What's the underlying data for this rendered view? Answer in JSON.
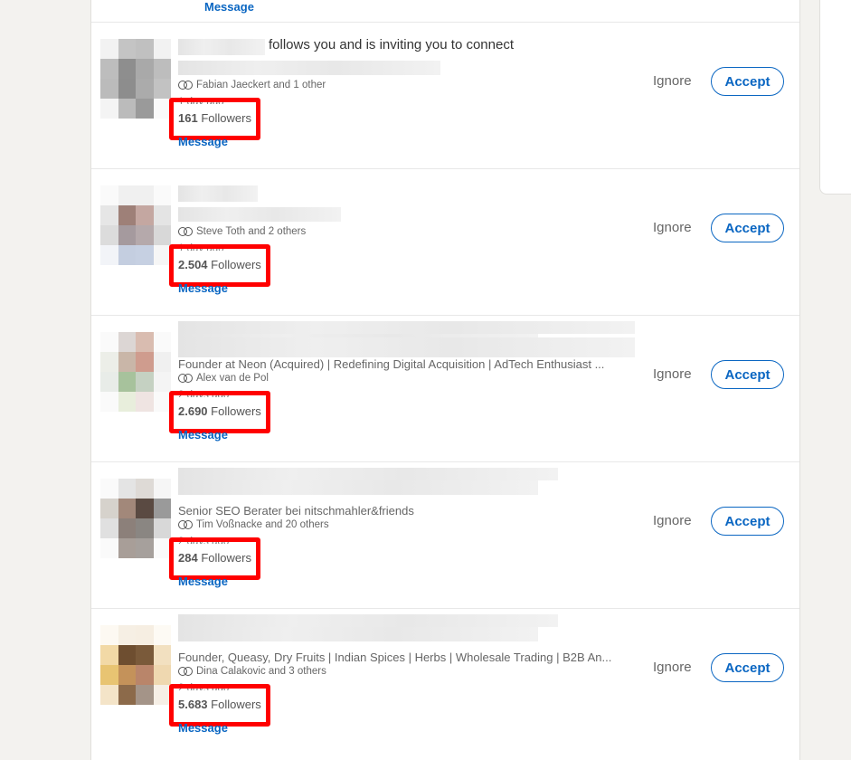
{
  "top_partial_link": "Message",
  "invitations": [
    {
      "name_suffix": "follows you and is inviting you to connect",
      "headline": "",
      "mutual": "Fabian Jaeckert and 1 other",
      "time": "1 day ago",
      "followers_count": "161",
      "followers_label": "Followers",
      "message": "Message",
      "ignore": "Ignore",
      "accept": "Accept",
      "avatar_colors": [
        "#f2f2f2",
        "#c4c4c4",
        "#c0c0c0",
        "#f2f2f2",
        "#bdbdbd",
        "#8e8e8e",
        "#a9a9a9",
        "#bdbdbd",
        "#bbbbbb",
        "#8d8d8d",
        "#ababab",
        "#c2c2c2",
        "#f4f4f4",
        "#bbbbbb",
        "#9a9a9a",
        "#fafafa"
      ]
    },
    {
      "name_suffix": "",
      "headline": "",
      "mutual": "Steve Toth and 2 others",
      "time": "1 day ago",
      "followers_count": "2.504",
      "followers_label": "Followers",
      "message": "Message",
      "ignore": "Ignore",
      "accept": "Accept",
      "avatar_colors": [
        "#fafafa",
        "#f0f0f0",
        "#f0f0f0",
        "#fafafa",
        "#e6e6e6",
        "#9e8078",
        "#c4a7a1",
        "#e4e4e4",
        "#dcdcdc",
        "#a59a9e",
        "#b5a9ab",
        "#d8d8d8",
        "#f2f4f8",
        "#c4cee0",
        "#c6d0e2",
        "#f6f6f6"
      ]
    },
    {
      "name_suffix": "",
      "headline": "Founder at Neon (Acquired) | Redefining Digital Acquisition | AdTech Enthusiast ...",
      "mutual": "Alex van de Pol",
      "time": "2 days ago",
      "followers_count": "2.690",
      "followers_label": "Followers",
      "message": "Message",
      "ignore": "Ignore",
      "accept": "Accept",
      "avatar_colors": [
        "#fafafa",
        "#dcd6d4",
        "#d9bcb0",
        "#fafafa",
        "#eceee8",
        "#c9b6a8",
        "#cf9c8e",
        "#f0f0f0",
        "#e8ece8",
        "#a7c29c",
        "#c5d1c2",
        "#f4f4f4",
        "#fafafa",
        "#e8eedc",
        "#efe4e2",
        "#fafafa"
      ]
    },
    {
      "name_suffix": "",
      "headline": "Senior SEO Berater bei nitschmahler&friends",
      "mutual": "Tim Voßnacke and 20 others",
      "time": "2 days ago",
      "followers_count": "284",
      "followers_label": "Followers",
      "message": "Message",
      "ignore": "Ignore",
      "accept": "Accept",
      "avatar_colors": [
        "#fafafa",
        "#e4e4e4",
        "#dedad6",
        "#f6f6f6",
        "#d6d2cc",
        "#a2887a",
        "#5a4a42",
        "#9a9a9a",
        "#e0e0e0",
        "#8c807a",
        "#8a8682",
        "#d8d8d8",
        "#fafafa",
        "#a89e98",
        "#a6a09c",
        "#fafafa"
      ]
    },
    {
      "name_suffix": "",
      "headline": "Founder, Queasy, Dry Fruits | Indian Spices | Herbs | Wholesale Trading | B2B An...",
      "mutual": "Dina Calakovic and 3 others",
      "time": "2 days ago",
      "followers_count": "5.683",
      "followers_label": "Followers",
      "message": "Message",
      "ignore": "Ignore",
      "accept": "Accept",
      "avatar_colors": [
        "#fdf9f2",
        "#f6efe4",
        "#f6eee2",
        "#fdfaf4",
        "#f2d9a6",
        "#6e4e30",
        "#7a5a3a",
        "#f2e0c0",
        "#e8c472",
        "#c4925a",
        "#b9856a",
        "#efd8b0",
        "#f4e4c8",
        "#8c6a4a",
        "#a49488",
        "#f6efe6"
      ]
    }
  ],
  "colors": {
    "accent": "#0a66c2",
    "highlight_box": "#ff0000",
    "page_background": "#f3f2ef"
  }
}
